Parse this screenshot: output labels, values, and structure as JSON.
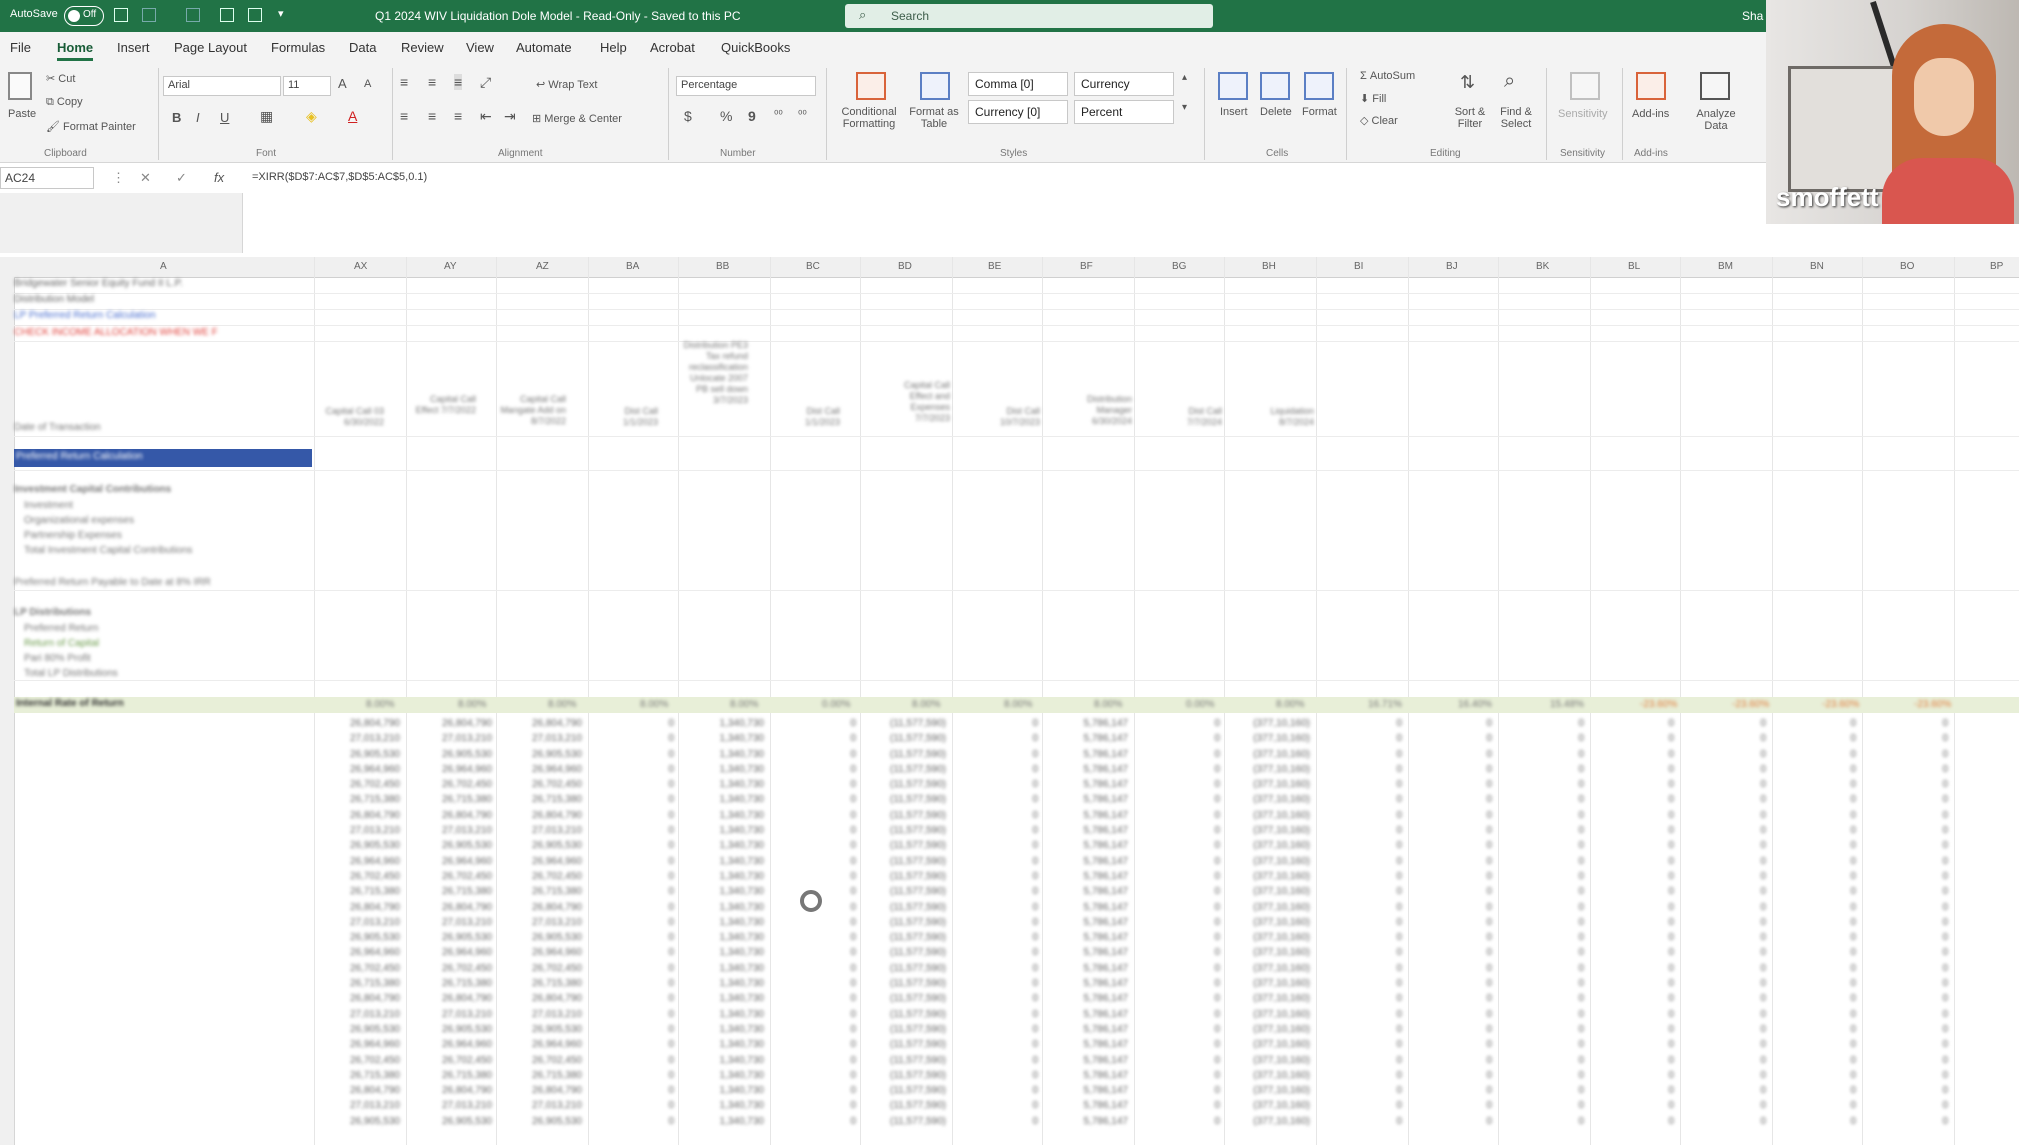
{
  "titlebar": {
    "autosave": "AutoSave",
    "autosave_state": "Off",
    "doc_title": "Q1 2024 WIV Liquidation Dole Model - Read-Only - Saved to this PC",
    "search_placeholder": "Search",
    "share": "Sha"
  },
  "menu": {
    "tabs": [
      "File",
      "Home",
      "Insert",
      "Page Layout",
      "Formulas",
      "Data",
      "Review",
      "View",
      "Automate",
      "Help",
      "Acrobat",
      "QuickBooks"
    ]
  },
  "ribbon": {
    "clipboard": {
      "paste": "Paste",
      "cut": "Cut",
      "copy": "Copy",
      "format_painter": "Format Painter",
      "group": "Clipboard"
    },
    "font": {
      "name": "Arial",
      "size": "11",
      "bold": "B",
      "italic": "I",
      "underline": "U",
      "grow": "A",
      "shrink": "A",
      "font_color": "A",
      "group": "Font"
    },
    "alignment": {
      "wrap_text": "Wrap Text",
      "merge_center": "Merge & Center",
      "group": "Alignment"
    },
    "number": {
      "format": "Percentage",
      "currency": "$",
      "percent": "%",
      "comma": "9",
      "group": "Number"
    },
    "styles": {
      "conditional_formatting": "Conditional Formatting",
      "format_as_table": "Format as Table",
      "cells": [
        "Comma [0]",
        "Currency",
        "Currency [0]",
        "Percent"
      ],
      "group": "Styles"
    },
    "cells": {
      "insert": "Insert",
      "delete": "Delete",
      "format": "Format",
      "group": "Cells"
    },
    "editing": {
      "autosum": "AutoSum",
      "fill": "Fill",
      "clear": "Clear",
      "sort_filter": "Sort & Filter",
      "find_select": "Find & Select",
      "group": "Editing"
    },
    "sensitivity": {
      "label": "Sensitivity",
      "group": "Sensitivity"
    },
    "addins": {
      "addins": "Add-ins",
      "analyze": "Analyze Data",
      "group": "Add-ins"
    }
  },
  "formulabar": {
    "name_box": "AC24",
    "cancel": "✕",
    "enter": "✓",
    "fx": "fx",
    "formula": "=XIRR($D$7:AC$7,$D$5:AC$5,0.1)"
  },
  "webcam": {
    "name": "smoffett"
  },
  "grid": {
    "columns": [
      "A",
      "AX",
      "AY",
      "AZ",
      "BA",
      "BB",
      "BC",
      "BD",
      "BE",
      "BF",
      "BG",
      "BH",
      "BI",
      "BJ",
      "BK",
      "BL",
      "BM",
      "BN",
      "BO",
      "BP"
    ],
    "header_rows": [
      {
        "text": "Bridgewater Senior Equity Fund II L.P.",
        "color": "#666666"
      },
      {
        "text": "Distribution Model",
        "color": "#666666"
      },
      {
        "text": "LP Preferred Return Calculation",
        "color": "#4a6fd0"
      },
      {
        "text": "CHECK INCOME ALLOCATION WHEN WE F",
        "color": "#e0403a"
      }
    ],
    "date_label": "Date of Transaction",
    "section_pref": "Preferred Return Calculation",
    "section_contrib": "Investment Capital Contributions",
    "contrib_rows": [
      "Investment",
      "Organizational expenses",
      "Partnership Expenses",
      "Total Investment Capital Contributions"
    ],
    "pref_due": "Preferred Return Payable to Date at 8% IRR",
    "section_dist": "LP Distributions",
    "dist_rows": [
      "Preferred Return",
      "Return of Capital",
      "Pari 80% Profit",
      "Total LP Distributions"
    ],
    "irr_label": "Internal Rate of Return",
    "col_headers": [
      "Capital Call 03 6/30/2022",
      "Capital Call Effect 7/7/2022",
      "Capital Call Mangate Add on 8/7/2022",
      "Dist Call 1/1/2023",
      "Distribution PE3 Tax refund reclassification Unlocate 2007 PB sell down 3/7/2023",
      "Dist Call 1/1/2023",
      "Capital Call Effect and Expenses 7/7/2023",
      "Dist Call 10/7/2023",
      "Distribution Manager 6/30/2024",
      "Dist Call 7/7/2024",
      "Liquidation 8/7/2024"
    ],
    "irr_values": [
      "8.00%",
      "8.00%",
      "8.00%",
      "8.00%",
      "8.00%",
      "0.00%",
      "8.00%",
      "8.00%",
      "8.00%",
      "0.00%",
      "8.00%",
      "16.71%",
      "16.40%",
      "15.48%",
      "-23.60%",
      "-23.60%",
      "-23.60%",
      "-23.60%"
    ],
    "detail_col_a": "26,804,790\n27,013,210\n26,905,530\n26,964,960\n26,702,450\n26,715,380\n26,804,790\n27,013,210\n26,905,530\n26,964,960\n26,702,450\n26,715,380\n26,804,790\n27,013,210\n26,905,530\n26,964,960\n26,702,450\n26,715,380\n26,804,790\n27,013,210\n26,905,530\n26,964,960\n26,702,450\n26,715,380\n26,804,790\n27,013,210\n26,905,530",
    "detail_zero": "0\n0\n0\n0\n0\n0\n0\n0\n0\n0\n0\n0\n0\n0\n0\n0\n0\n0\n0\n0\n0\n0\n0\n0\n0\n0\n0",
    "detail_col_b": "1,340,730\n1,340,730\n1,340,730\n1,340,730\n1,340,730\n1,340,730\n1,340,730\n1,340,730\n1,340,730\n1,340,730\n1,340,730\n1,340,730\n1,340,730\n1,340,730\n1,340,730\n1,340,730\n1,340,730\n1,340,730\n1,340,730\n1,340,730\n1,340,730\n1,340,730\n1,340,730\n1,340,730\n1,340,730\n1,340,730\n1,340,730",
    "detail_col_c": "(11,577,590)\n(11,577,590)\n(11,577,590)\n(11,577,590)\n(11,577,590)\n(11,577,590)\n(11,577,590)\n(11,577,590)\n(11,577,590)\n(11,577,590)\n(11,577,590)\n(11,577,590)\n(11,577,590)\n(11,577,590)\n(11,577,590)\n(11,577,590)\n(11,577,590)\n(11,577,590)\n(11,577,590)\n(11,577,590)\n(11,577,590)\n(11,577,590)\n(11,577,590)\n(11,577,590)\n(11,577,590)\n(11,577,590)\n(11,577,590)",
    "detail_col_d": "5,786,147\n5,786,147\n5,786,147\n5,786,147\n5,786,147\n5,786,147\n5,786,147\n5,786,147\n5,786,147\n5,786,147\n5,786,147\n5,786,147\n5,786,147\n5,786,147\n5,786,147\n5,786,147\n5,786,147\n5,786,147\n5,786,147\n5,786,147\n5,786,147\n5,786,147\n5,786,147\n5,786,147\n5,786,147\n5,786,147\n5,786,147",
    "detail_col_e": "(377,10,160)\n(377,10,160)\n(377,10,160)\n(377,10,160)\n(377,10,160)\n(377,10,160)\n(377,10,160)\n(377,10,160)\n(377,10,160)\n(377,10,160)\n(377,10,160)\n(377,10,160)\n(377,10,160)\n(377,10,160)\n(377,10,160)\n(377,10,160)\n(377,10,160)\n(377,10,160)\n(377,10,160)\n(377,10,160)\n(377,10,160)\n(377,10,160)\n(377,10,160)\n(377,10,160)\n(377,10,160)\n(377,10,160)\n(377,10,160)"
  }
}
